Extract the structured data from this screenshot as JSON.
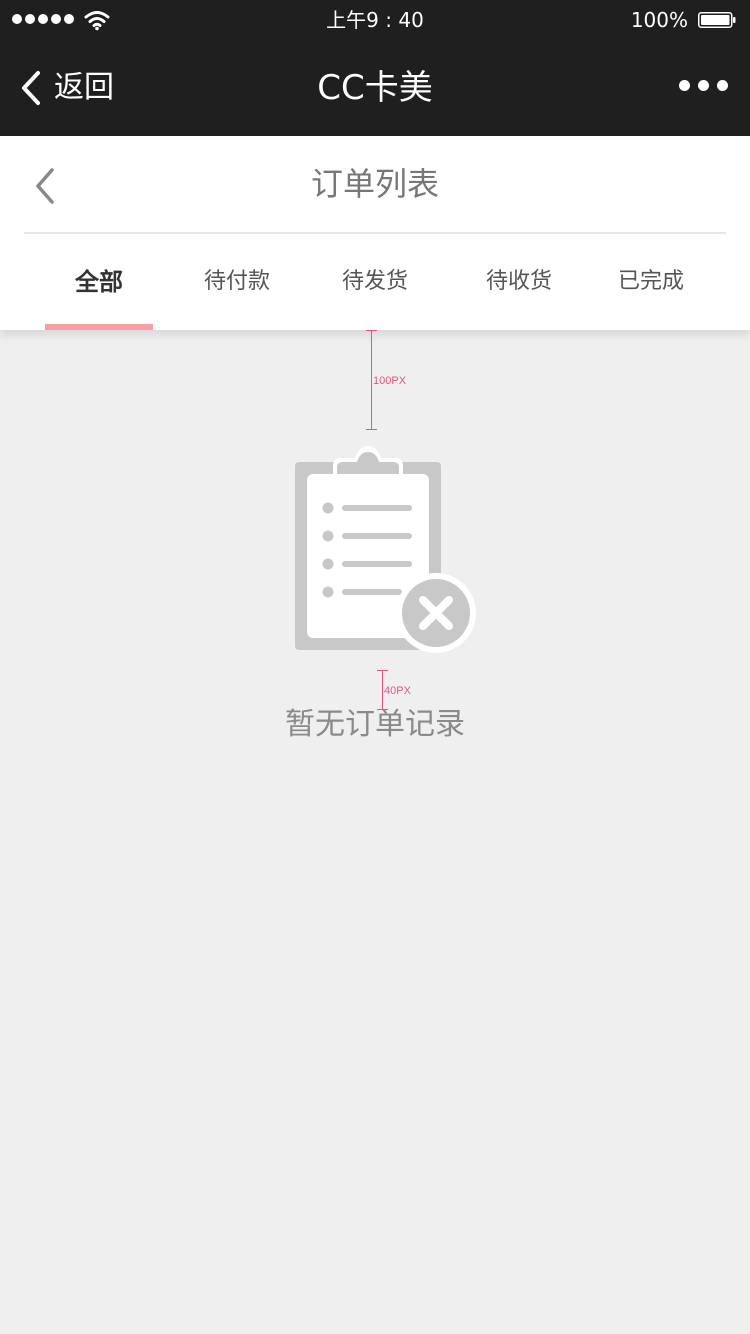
{
  "status_bar": {
    "time": "上午9 : 40",
    "battery": "100%"
  },
  "nav": {
    "back_label": "返回",
    "title": "CC卡美"
  },
  "page": {
    "title": "订单列表"
  },
  "tabs": [
    {
      "label": "全部",
      "active": true
    },
    {
      "label": "待付款",
      "active": false
    },
    {
      "label": "待发货",
      "active": false
    },
    {
      "label": "待收货",
      "active": false
    },
    {
      "label": "已完成",
      "active": false
    }
  ],
  "annotations": {
    "top_spacing": "100PX",
    "text_spacing": "40PX"
  },
  "empty_state": {
    "message": "暂无订单记录",
    "icon": "clipboard-x-icon"
  },
  "colors": {
    "header_bg": "#1f1f1f",
    "tab_indicator": "#f7a0a3",
    "page_bg": "#efefef",
    "icon_gray": "#c8c8c8",
    "annotation": "#e5557f"
  }
}
